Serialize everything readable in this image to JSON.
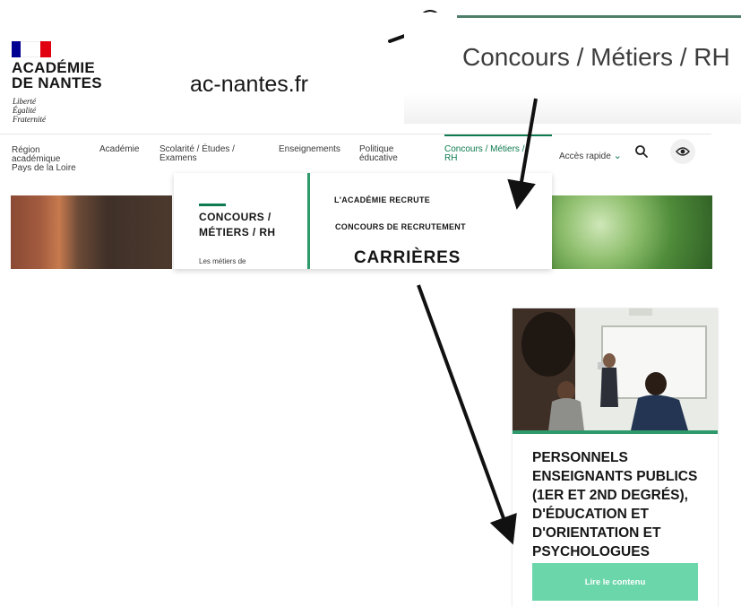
{
  "logo": {
    "org_name": "ACADÉMIE\nDE NANTES",
    "motto": "Liberté\nÉgalité\nFraternité",
    "icon": "french-republic-flag-icon"
  },
  "site_name": "ac-nantes.fr",
  "zoom": {
    "icon": "magnifier-icon",
    "page_title": "Concours / Métiers / RH"
  },
  "nav": {
    "items": [
      {
        "label": "Région\nacadémique\nPays de la Loire"
      },
      {
        "label": "Académie"
      },
      {
        "label": "Scolarité / Études /\nExamens"
      },
      {
        "label": "Enseignements"
      },
      {
        "label": "Politique\néducative"
      },
      {
        "label": "Concours / Métiers /\nRH"
      }
    ],
    "quick_access": "Accès rapide",
    "search_icon": "search-icon",
    "accessibility_icon": "eye-icon",
    "accent_color": "#0e7a50"
  },
  "dropdown": {
    "heading": "CONCOURS /\nMÉTIERS / RH",
    "link": "Les métiers de",
    "items": [
      "L'ACADÉMIE RECRUTE",
      "CONCOURS DE RECRUTEMENT"
    ],
    "big_item": "CARRIÈRES"
  },
  "card": {
    "title": "PERSONNELS ENSEIGNANTS PUBLICS (1ER ET 2ND DEGRÉS), D'ÉDUCATION ET D'ORIENTATION ET PSYCHOLOGUES",
    "button": "Lire le contenu",
    "button_color": "#6cd6ab"
  }
}
